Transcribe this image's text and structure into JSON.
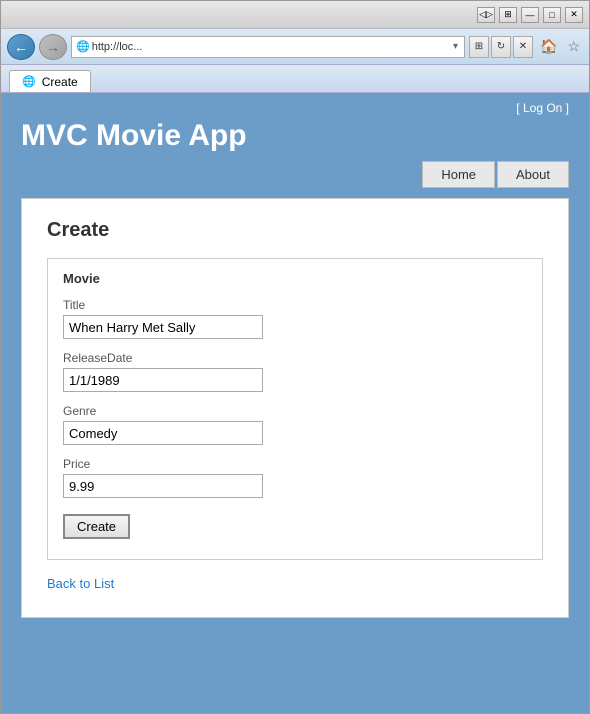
{
  "browser": {
    "title_bar_buttons": [
      "◁▷",
      "□",
      "—",
      "⊡",
      "✕"
    ],
    "address": "http://loc...",
    "tab_label": "Create",
    "tab_favicon": "🌐"
  },
  "header": {
    "logon_label": "[ Log On ]",
    "app_title": "MVC Movie App",
    "nav": {
      "home": "Home",
      "about": "About"
    }
  },
  "main": {
    "page_title": "Create",
    "form": {
      "section_title": "Movie",
      "fields": [
        {
          "label": "Title",
          "value": "When Harry Met Sally",
          "id": "title"
        },
        {
          "label": "ReleaseDate",
          "value": "1/1/1989",
          "id": "releasedate"
        },
        {
          "label": "Genre",
          "value": "Comedy",
          "id": "genre"
        },
        {
          "label": "Price",
          "value": "9.99",
          "id": "price"
        }
      ],
      "submit_label": "Create"
    },
    "back_link": "Back to List"
  }
}
